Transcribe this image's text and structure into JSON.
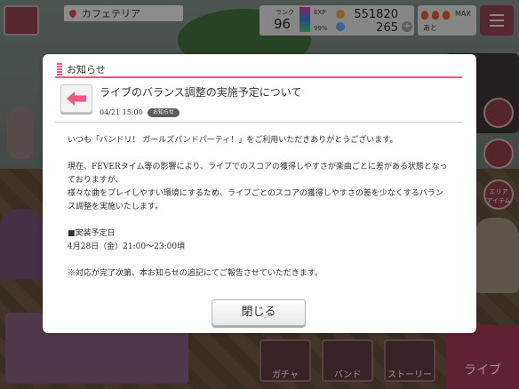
{
  "hud": {
    "location": "カフェテリア",
    "rank_label": "ランク",
    "rank_value": "96",
    "exp_label": "EXP",
    "exp_percent": "99%",
    "money": "551820",
    "stars": "265",
    "live_max": "MAX",
    "live_remaining": "あと"
  },
  "side_buttons": {
    "area_item": "エリア\nアイテム"
  },
  "nav": {
    "gacha": "ガチャ",
    "band": "バンド",
    "story": "ストーリー",
    "live": "ライブ"
  },
  "dialog": {
    "header": "お知らせ",
    "notice_title": "ライブのバランス調整の実施予定について",
    "date": "04/21 15:00",
    "tag": "お知らせ",
    "body": [
      "いつも「バンドリ！ ガールズバンドパーティ！」をご利用いただきありがとうございます。",
      "",
      "現在、FEVERタイム等の影響により、ライブでのスコアの獲得しやすさが楽曲ごとに差がある状態となっておりますが、",
      "様々な曲をプレイしやすい環境にするため、ライブごとのスコアの獲得しやすさの差を少なくするバランス調整を実施いたします。",
      "",
      "■実装予定日",
      "4月28日（金）21:00〜23:00頃",
      "",
      "※対応が完了次第、本お知らせの追記にてご報告させていただきます。"
    ],
    "close_label": "閉じる"
  },
  "colors": {
    "accent": "#f05a7e",
    "tag_bg": "#5c5c5c"
  }
}
